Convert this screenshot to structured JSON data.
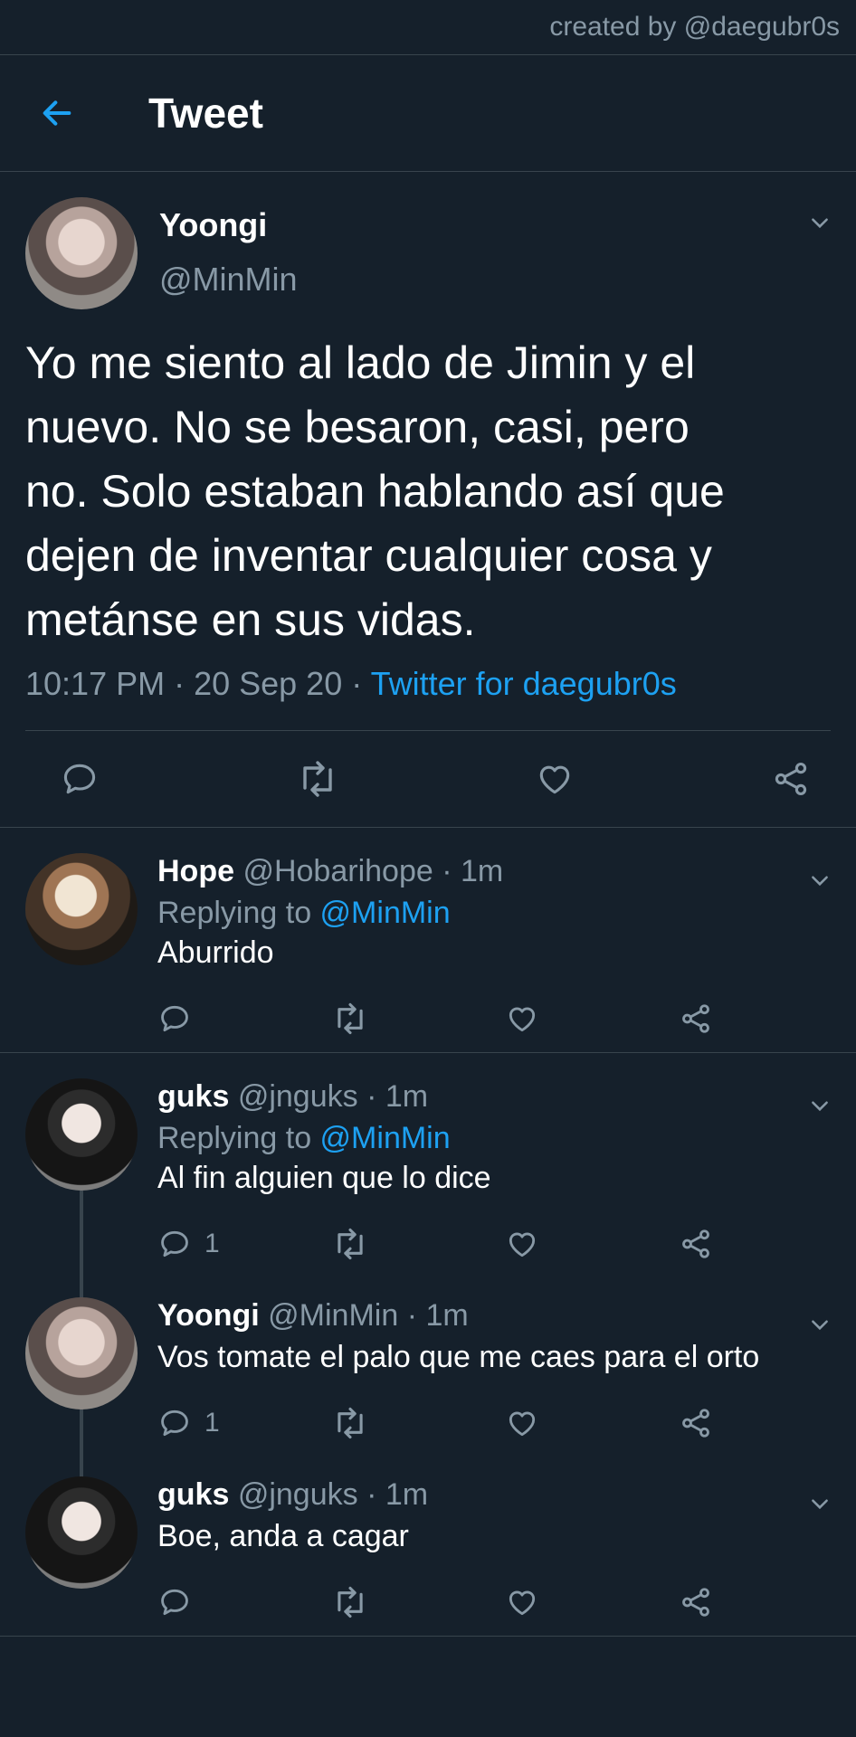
{
  "credit": "created by @daegubr0s",
  "header": {
    "title": "Tweet"
  },
  "main_tweet": {
    "name": "Yoongi",
    "handle": "@MinMin",
    "text": "Yo me siento al lado de Jimin y el\nnuevo. No se besaron, casi, pero\nno. Solo estaban hablando así que\ndejen de inventar cualquier cosa y\nmetánse en sus vidas.",
    "time": "10:17 PM · 20 Sep 20 · ",
    "source": "Twitter for daegubr0s"
  },
  "replies": [
    {
      "name": "Hope",
      "handle": "@Hobarihope",
      "time": "· 1m",
      "replying_prefix": "Replying to ",
      "replying_to": "@MinMin",
      "text": "Aburrido",
      "reply_count": ""
    },
    {
      "name": "guks",
      "handle": "@jnguks",
      "time": "· 1m",
      "replying_prefix": "Replying to ",
      "replying_to": "@MinMin",
      "text": "Al fin alguien que lo dice",
      "reply_count": "1"
    },
    {
      "name": "Yoongi",
      "handle": "@MinMin",
      "time": "· 1m",
      "text": "Vos tomate el palo que me caes para el orto",
      "reply_count": "1"
    },
    {
      "name": "guks",
      "handle": "@jnguks",
      "time": "· 1m",
      "text": "Boe, anda a cagar",
      "reply_count": ""
    }
  ],
  "colors": {
    "background": "#15202b",
    "accent": "#1da1f2",
    "secondary_text": "#8899a6",
    "divider": "#38444d"
  },
  "icons": [
    "back-arrow-icon",
    "chevron-down-icon",
    "reply-icon",
    "retweet-icon",
    "like-icon",
    "share-icon"
  ]
}
